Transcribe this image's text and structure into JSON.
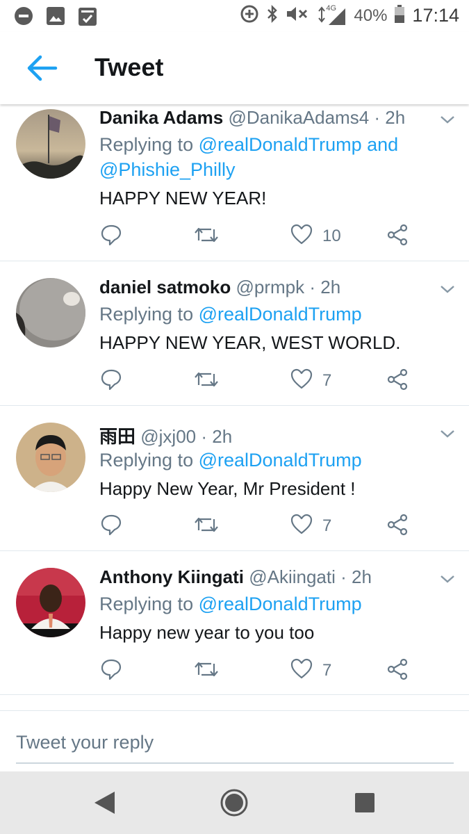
{
  "status_bar": {
    "left_icons": [
      "minus-circle-icon",
      "image-icon",
      "clipboard-check-icon"
    ],
    "right_icons": [
      "data-saver-icon",
      "bluetooth-icon",
      "volume-muted-icon",
      "network-4g-icon",
      "signal-icon",
      "battery-icon"
    ],
    "network_label": "4G",
    "battery": "40%",
    "time": "17:14"
  },
  "appbar": {
    "title": "Tweet"
  },
  "tweets": [
    {
      "name": "Danika Adams",
      "handle": "@DanikaAdams4",
      "time": "· 2h",
      "replying_prefix": "Replying to ",
      "mentions_line1": "@realDonaldTrump",
      "joiner": " and",
      "mentions_line2": "@Phishie_Philly",
      "text": "HAPPY NEW YEAR!",
      "likes": "10"
    },
    {
      "name": "daniel satmoko",
      "handle": "@prmpk",
      "time": "· 2h",
      "replying_prefix": "Replying to ",
      "mentions_line1": "@realDonaldTrump",
      "text": "HAPPY NEW YEAR, WEST WORLD.",
      "likes": "7"
    },
    {
      "name": "雨田",
      "handle": "@jxj00",
      "time": "· 2h",
      "replying_prefix": "Replying to ",
      "mentions_line1": "@realDonaldTrump",
      "text": "Happy New Year, Mr President !",
      "likes": "7"
    },
    {
      "name": "Anthony Kiingati",
      "handle": "@Akiingati",
      "time": "· 2h",
      "replying_prefix": "Replying to ",
      "mentions_line1": "@realDonaldTrump",
      "text": "Happy new year to you too",
      "likes": "7"
    }
  ],
  "composer": {
    "placeholder": "Tweet your reply"
  },
  "navbar": {
    "icons": [
      "back-triangle-icon",
      "home-circle-icon",
      "recents-square-icon"
    ]
  },
  "colors": {
    "accent": "#1da1f2",
    "secondary_text": "#657786",
    "divider": "#e1e8ed"
  }
}
